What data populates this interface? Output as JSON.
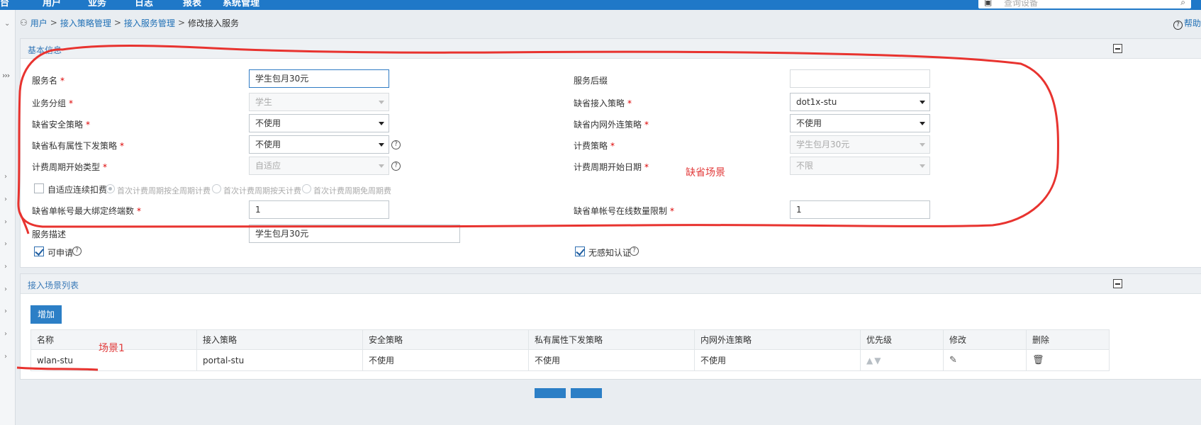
{
  "topbar": {
    "menus": [
      "台",
      "用户",
      "业务",
      "日志",
      "报表",
      "系统管理"
    ],
    "search_placeholder": "查询设备"
  },
  "breadcrumb": {
    "items": [
      "用户",
      "接入策略管理",
      "接入服务管理"
    ],
    "current": "修改接入服务"
  },
  "help": "帮助",
  "basic_info": {
    "title": "基本信息",
    "service_name": {
      "label": "服务名",
      "value": "学生包月30元"
    },
    "service_suffix": {
      "label": "服务后缀",
      "value": ""
    },
    "business_group": {
      "label": "业务分组",
      "value": "学生"
    },
    "default_access_policy": {
      "label": "缺省接入策略",
      "value": "dot1x-stu"
    },
    "default_security_policy": {
      "label": "缺省安全策略",
      "value": "不使用"
    },
    "default_intranet_policy": {
      "label": "缺省内网外连策略",
      "value": "不使用"
    },
    "default_private_attr_policy": {
      "label": "缺省私有属性下发策略",
      "value": "不使用"
    },
    "billing_policy": {
      "label": "计费策略",
      "value": "学生包月30元"
    },
    "billing_cycle_type": {
      "label": "计费周期开始类型",
      "value": "自适应"
    },
    "billing_cycle_date": {
      "label": "计费周期开始日期",
      "value": "不限"
    },
    "adaptive_deduction": {
      "label": "自适应连续扣费",
      "checked": false
    },
    "radio_options": [
      "首次计费周期按全周期计费",
      "首次计费周期按天计费",
      "首次计费周期免周期费"
    ],
    "max_bind_terminals": {
      "label": "缺省单帐号最大绑定终端数",
      "value": "1"
    },
    "max_online": {
      "label": "缺省单帐号在线数量限制",
      "value": "1"
    },
    "description": {
      "label": "服务描述",
      "value": "学生包月30元"
    },
    "applicable": {
      "label": "可申请",
      "checked": true
    },
    "seamless_auth": {
      "label": "无感知认证",
      "checked": true
    },
    "annotation": "缺省场景"
  },
  "scene_list": {
    "title": "接入场景列表",
    "add_label": "增加",
    "columns": [
      "名称",
      "接入策略",
      "安全策略",
      "私有属性下发策略",
      "内网外连策略",
      "优先级",
      "修改",
      "删除"
    ],
    "rows": [
      {
        "name": "wlan-stu",
        "access": "portal-stu",
        "security": "不使用",
        "private": "不使用",
        "intranet": "不使用"
      }
    ],
    "annotation": "场景1"
  },
  "colors": {
    "accent": "#1f78c8",
    "annotation": "#e23b3b"
  }
}
